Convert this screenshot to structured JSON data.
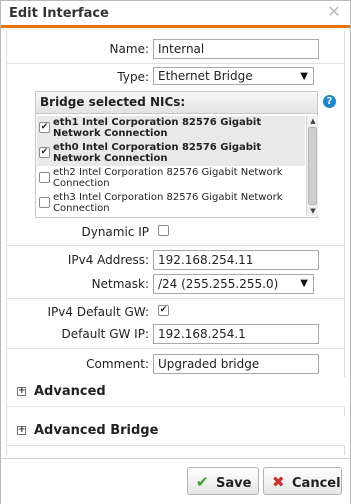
{
  "dialog": {
    "title": "Edit Interface",
    "close_icon": "close-icon"
  },
  "form": {
    "name_label": "Name:",
    "name_value": "Internal",
    "type_label": "Type:",
    "type_value": "Ethernet Bridge",
    "nics_title": "Bridge selected NICs:",
    "nics": [
      {
        "label": "eth1 Intel Corporation 82576 Gigabit Network Connection",
        "checked": true
      },
      {
        "label": "eth0 Intel Corporation 82576 Gigabit Network Connection",
        "checked": true
      },
      {
        "label": "eth2 Intel Corporation 82576 Gigabit Network Connection",
        "checked": false
      },
      {
        "label": "eth3 Intel Corporation 82576 Gigabit Network Connection",
        "checked": false
      }
    ],
    "dynamic_ip_label": "Dynamic IP",
    "dynamic_ip_checked": false,
    "ipv4_label": "IPv4 Address:",
    "ipv4_value": "192.168.254.11",
    "netmask_label": "Netmask:",
    "netmask_value": "/24 (255.255.255.0)",
    "default_gw_label": "IPv4 Default GW:",
    "default_gw_checked": true,
    "default_gw_ip_label": "Default GW IP:",
    "default_gw_ip_value": "192.168.254.1",
    "comment_label": "Comment:",
    "comment_value": "Upgraded bridge"
  },
  "sections": {
    "advanced": "Advanced",
    "advanced_bridge": "Advanced Bridge"
  },
  "buttons": {
    "save": "Save",
    "cancel": "Cancel"
  },
  "colors": {
    "accent": "#e8740f",
    "help": "#1d86d0",
    "save_icon": "#3a9d27",
    "cancel_icon": "#d0302b"
  }
}
